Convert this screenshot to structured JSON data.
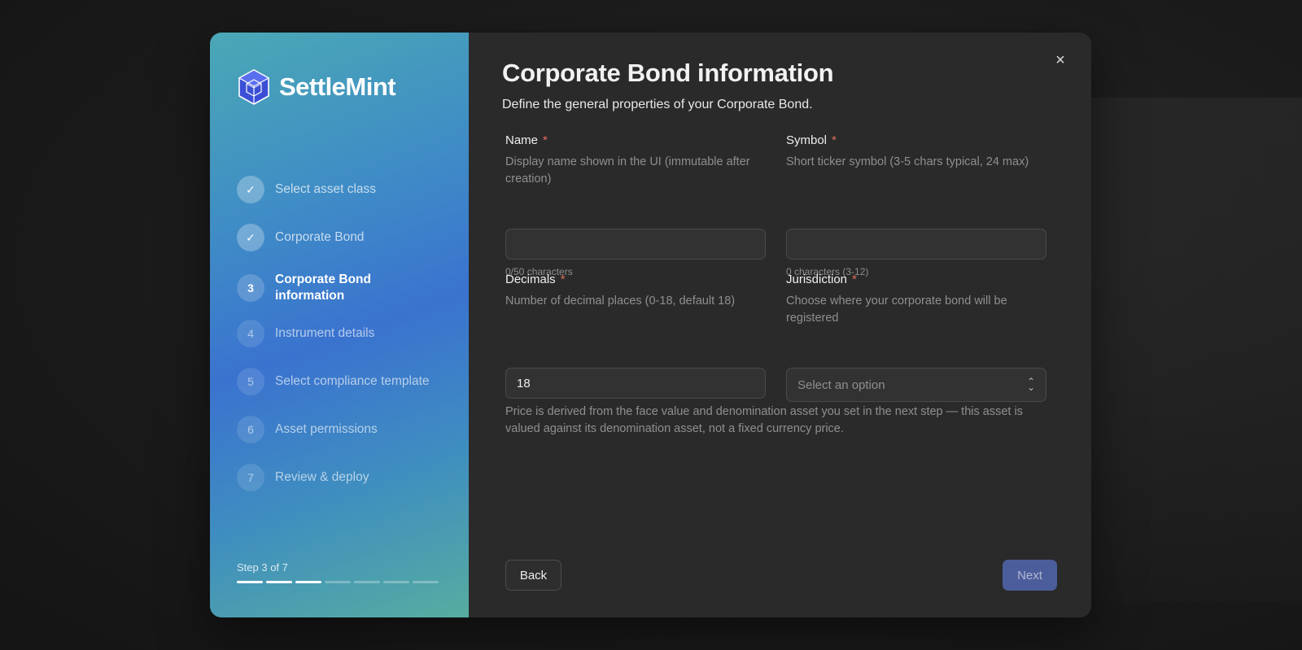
{
  "brand": {
    "name": "SettleMint",
    "logo_icon": "cube-icon"
  },
  "steps": [
    {
      "number": "✓",
      "label": "Select asset class",
      "state": "done"
    },
    {
      "number": "✓",
      "label": "Corporate Bond",
      "state": "done"
    },
    {
      "number": "3",
      "label": "Corporate Bond information",
      "state": "current"
    },
    {
      "number": "4",
      "label": "Instrument details",
      "state": "upcoming"
    },
    {
      "number": "5",
      "label": "Select compliance template",
      "state": "upcoming"
    },
    {
      "number": "6",
      "label": "Asset permissions",
      "state": "upcoming"
    },
    {
      "number": "7",
      "label": "Review & deploy",
      "state": "upcoming"
    }
  ],
  "progress": {
    "text": "Step 3 of 7",
    "current": 3,
    "total": 7
  },
  "form": {
    "title": "Corporate Bond information",
    "subtitle": "Define the general properties of your Corporate Bond.",
    "name": {
      "label": "Name",
      "required_mark": "*",
      "help": "Display name shown in the UI (immutable after creation)",
      "value": "",
      "counter": "0/50 characters"
    },
    "symbol": {
      "label": "Symbol",
      "required_mark": "*",
      "help": "Short ticker symbol (3-5 chars typical, 24 max)",
      "value": "",
      "counter": "0 characters (3-12)"
    },
    "decimals": {
      "label": "Decimals",
      "required_mark": "*",
      "help": "Number of decimal places (0-18, default 18)",
      "value": "18"
    },
    "jurisdiction": {
      "label": "Jurisdiction",
      "required_mark": "*",
      "help": "Choose where your corporate bond will be registered",
      "placeholder": "Select an option"
    },
    "note": "Price is derived from the face value and denomination asset you set in the next step — this asset is valued against its denomination asset, not a fixed currency price."
  },
  "buttons": {
    "back": "Back",
    "next": "Next",
    "close": "×"
  },
  "colors": {
    "accent": "#4c5d9b",
    "required": "#e06d5b",
    "panel": "#2a2a2a"
  }
}
